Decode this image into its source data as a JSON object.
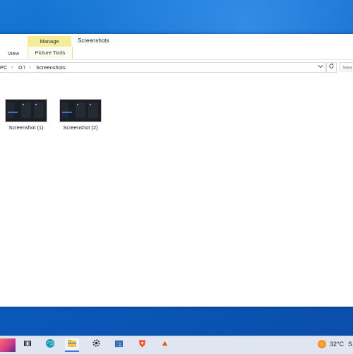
{
  "window": {
    "title": "Screenshots",
    "ribbon": {
      "contextual_tab": "Manage",
      "tabs": [
        {
          "label": "View"
        },
        {
          "label": "Picture Tools"
        }
      ]
    },
    "address": {
      "crumbs": [
        "PC",
        "D:\\",
        "Screenshots"
      ],
      "separator": "›",
      "dropdown_icon": "chevron-down-icon",
      "refresh_icon": "refresh-icon",
      "search_placeholder": "Sea"
    },
    "files": [
      {
        "name": "Screenshot (1)"
      },
      {
        "name": "Screenshot (2)"
      }
    ]
  },
  "taskbar": {
    "icons": [
      {
        "name": "task-view-icon",
        "glyph": "⊞"
      },
      {
        "name": "edge-icon",
        "glyph": "◉"
      },
      {
        "name": "file-explorer-icon",
        "glyph": "▬"
      },
      {
        "name": "settings-icon",
        "glyph": "⚙"
      },
      {
        "name": "store-icon",
        "glyph": "▦"
      },
      {
        "name": "brave-icon",
        "glyph": "▼"
      },
      {
        "name": "app-icon",
        "glyph": "▲"
      }
    ],
    "weather": {
      "temperature": "32°C",
      "condition": "S"
    }
  },
  "colors": {
    "manage_tab": "#f4ec9a",
    "desktop": "#0c63c6",
    "taskbar": "#dfe6f2"
  }
}
